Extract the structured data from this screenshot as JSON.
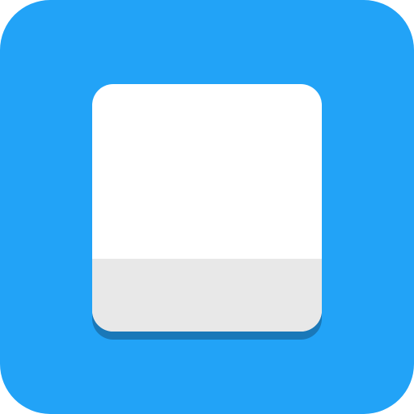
{
  "icon": {
    "name": "blank-document-app-icon",
    "colors": {
      "background": "#22A3F7",
      "card_top": "#FFFFFF",
      "card_bottom": "#E8E8E8",
      "card_shadow": "#1A78B8"
    }
  }
}
